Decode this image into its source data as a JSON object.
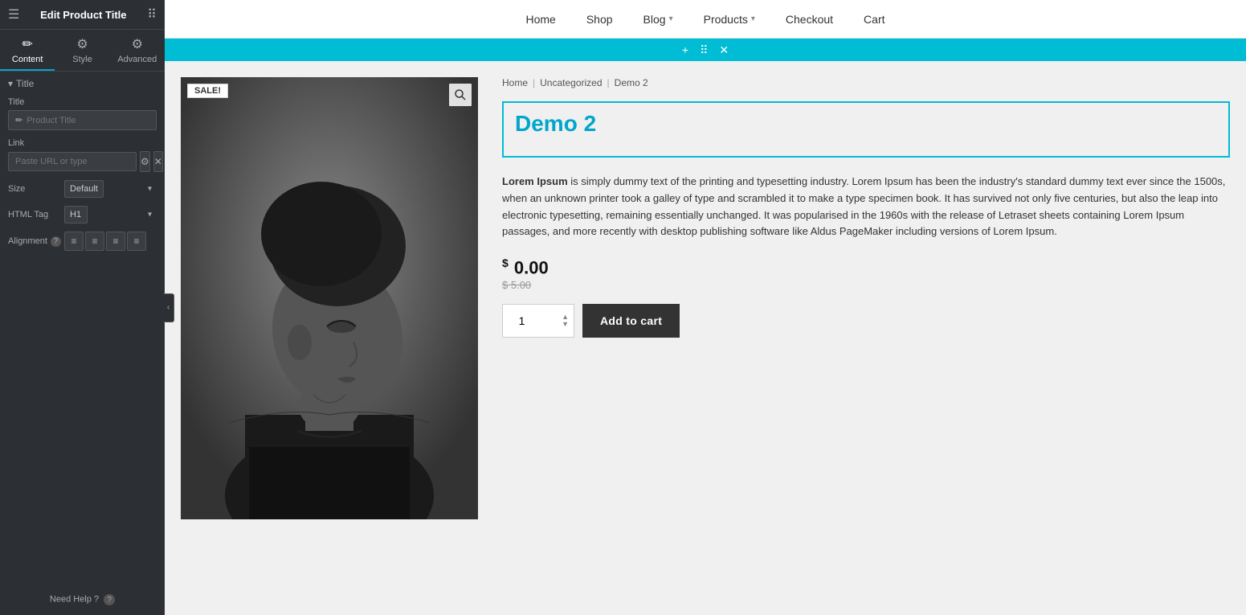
{
  "sidebar": {
    "header": {
      "title": "Edit Product Title",
      "hamburger_label": "≡",
      "grid_label": "⊞"
    },
    "tabs": [
      {
        "id": "content",
        "label": "Content",
        "active": true
      },
      {
        "id": "style",
        "label": "Style",
        "active": false
      },
      {
        "id": "advanced",
        "label": "Advanced",
        "active": false
      }
    ],
    "section": {
      "title": "Title"
    },
    "fields": {
      "title_label": "Title",
      "title_placeholder": "Product Title",
      "link_label": "Link",
      "link_placeholder": "Paste URL or type",
      "size_label": "Size",
      "size_default": "Default",
      "html_tag_label": "HTML Tag",
      "html_tag_default": "H1",
      "alignment_label": "Alignment"
    },
    "help": "Need Help ?"
  },
  "nav": {
    "items": [
      {
        "label": "Home",
        "dropdown": false
      },
      {
        "label": "Shop",
        "dropdown": false
      },
      {
        "label": "Blog",
        "dropdown": true
      },
      {
        "label": "Products",
        "dropdown": true
      },
      {
        "label": "Checkout",
        "dropdown": false
      },
      {
        "label": "Cart",
        "dropdown": false
      }
    ]
  },
  "toolbar": {
    "add_label": "+",
    "move_label": "⠿",
    "close_label": "✕"
  },
  "product": {
    "sale_badge": "SALE!",
    "breadcrumb": {
      "home": "Home",
      "category": "Uncategorized",
      "current": "Demo 2"
    },
    "title": "Demo 2",
    "description": "Lorem Ipsum is simply dummy text of the printing and typesetting industry. Lorem Ipsum has been the industry's standard dummy text ever since the 1500s, when an unknown printer took a galley of type and scrambled it to make a type specimen book. It has survived not only five centuries, but also the leap into electronic typesetting, remaining essentially unchanged. It was popularised in the 1960s with the release of Letraset sheets containing Lorem Ipsum passages, and more recently with desktop publishing software like Aldus PageMaker including versions of Lorem Ipsum.",
    "price_current": "0.00",
    "price_original": "5.00",
    "currency": "$",
    "quantity": "1",
    "add_to_cart_label": "Add to cart"
  },
  "colors": {
    "accent": "#00bcd4",
    "link": "#00a6cc",
    "sidebar_bg": "#2c2f34"
  }
}
